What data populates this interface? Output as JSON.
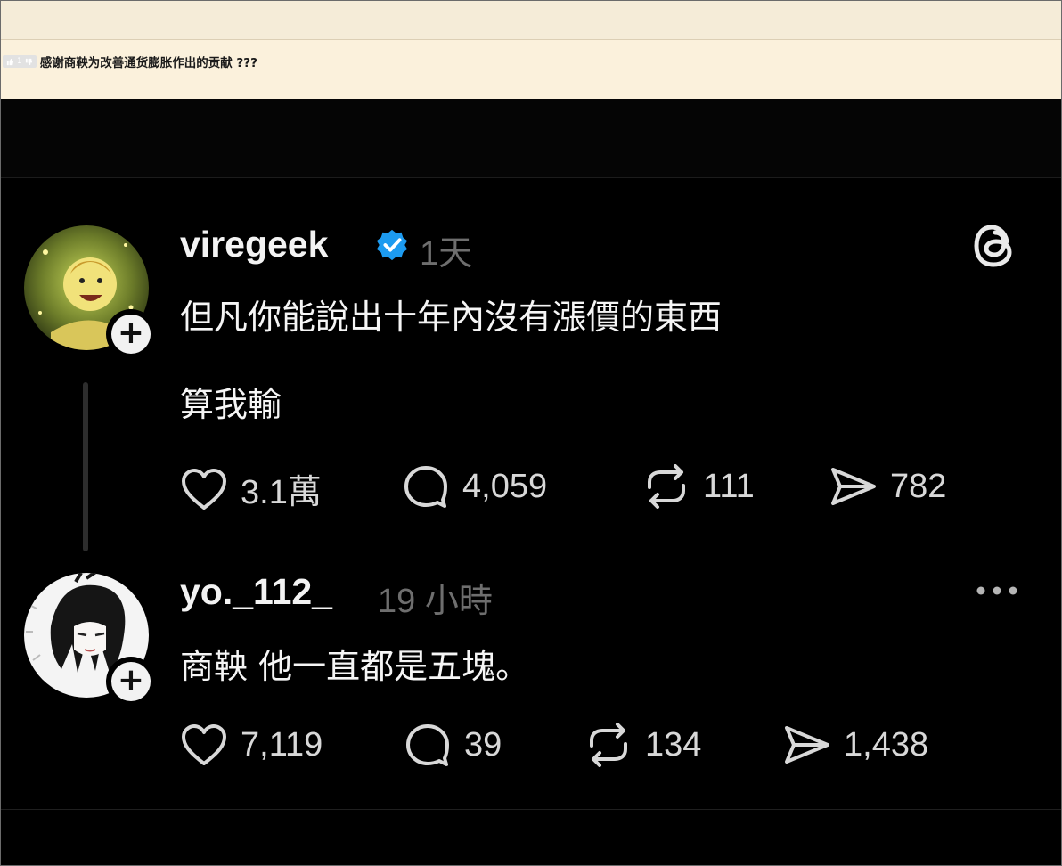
{
  "forum": {
    "upvote_count": "1",
    "title": "感谢商鞅为改善通货膨胀作出的贡献 ???"
  },
  "posts": [
    {
      "username": "viregeek",
      "verified": true,
      "time": "1天",
      "lines": [
        "但凡你能說出十年內沒有漲價的東西",
        "算我輸"
      ],
      "likes": "3.1萬",
      "comments": "4,059",
      "reposts": "111",
      "shares": "782",
      "corner_icon": "threads-logo-icon"
    },
    {
      "username": "yo._112_",
      "verified": false,
      "time": "19 小時",
      "lines": [
        "商鞅 他一直都是五塊。"
      ],
      "likes": "7,119",
      "comments": "39",
      "reposts": "134",
      "shares": "1,438",
      "corner_icon": "more-options-icon"
    }
  ],
  "colors": {
    "background": "#000000",
    "text": "#f5f5f5",
    "muted": "#6e6e6e",
    "verified": "#1d9bf0",
    "forum_bar": "#fbf1dc"
  }
}
